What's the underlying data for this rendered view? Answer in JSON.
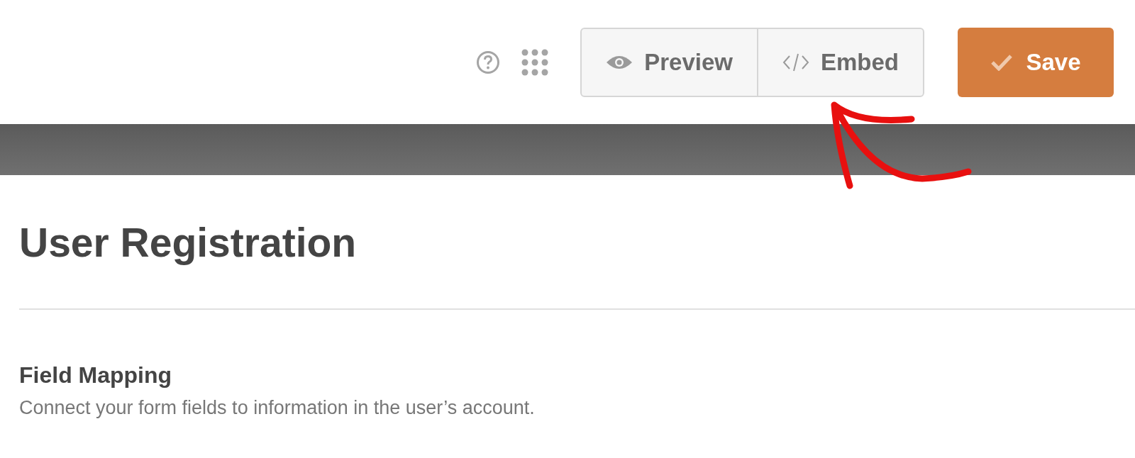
{
  "toolbar": {
    "buttons": [
      {
        "kind": "preview",
        "label": "Preview"
      },
      {
        "kind": "embed",
        "label": "Embed"
      }
    ],
    "save": {
      "label": "Save"
    }
  },
  "title": "User Registration",
  "section": {
    "heading": "Field Mapping",
    "description": "Connect your form fields to information in the user’s account."
  }
}
